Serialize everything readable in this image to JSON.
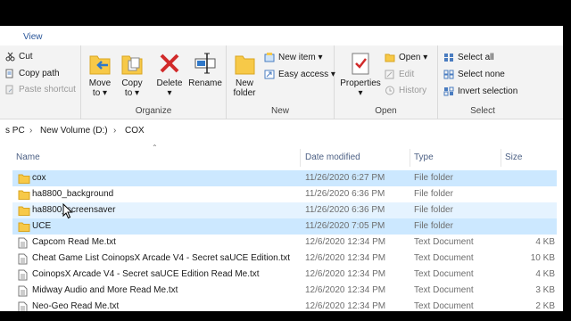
{
  "ribbon": {
    "tab": "View",
    "clipboard": {
      "cut": "Cut",
      "copy_path": "Copy path",
      "paste_shortcut": "Paste shortcut"
    },
    "organize": {
      "move_to": "Move",
      "move_to2": "to ▾",
      "copy_to": "Copy",
      "copy_to2": "to ▾",
      "delete": "Delete",
      "delete2": "▾",
      "rename": "Rename",
      "label": "Organize"
    },
    "new": {
      "new_folder": "New",
      "new_folder2": "folder",
      "new_item": "New item ▾",
      "easy_access": "Easy access ▾",
      "label": "New"
    },
    "open": {
      "properties": "Properties",
      "properties2": "▾",
      "open": "Open ▾",
      "edit": "Edit",
      "history": "History",
      "label": "Open"
    },
    "select": {
      "select_all": "Select all",
      "select_none": "Select none",
      "invert": "Invert selection",
      "label": "Select"
    }
  },
  "address": {
    "seg1": "s PC",
    "seg2": "New Volume (D:)",
    "seg3": "COX",
    "sep": "›"
  },
  "columns": {
    "name": "Name",
    "date": "Date modified",
    "type": "Type",
    "size": "Size"
  },
  "files": [
    {
      "name": "cox",
      "date": "11/26/2020 6:27 PM",
      "type": "File folder",
      "size": "",
      "kind": "folder",
      "state": "sel"
    },
    {
      "name": "ha8800_background",
      "date": "11/26/2020 6:36 PM",
      "type": "File folder",
      "size": "",
      "kind": "folder",
      "state": ""
    },
    {
      "name": "ha8800_screensaver",
      "date": "11/26/2020 6:36 PM",
      "type": "File folder",
      "size": "",
      "kind": "folder",
      "state": "hover"
    },
    {
      "name": "UCE",
      "date": "11/26/2020 7:05 PM",
      "type": "File folder",
      "size": "",
      "kind": "folder",
      "state": "sel"
    },
    {
      "name": "Capcom Read Me.txt",
      "date": "12/6/2020 12:34 PM",
      "type": "Text Document",
      "size": "4 KB",
      "kind": "txt",
      "state": ""
    },
    {
      "name": "Cheat Game List CoinopsX Arcade V4 - Secret saUCE Edition.txt",
      "date": "12/6/2020 12:34 PM",
      "type": "Text Document",
      "size": "10 KB",
      "kind": "txt",
      "state": ""
    },
    {
      "name": "CoinopsX Arcade V4 - Secret saUCE Edition Read Me.txt",
      "date": "12/6/2020 12:34 PM",
      "type": "Text Document",
      "size": "4 KB",
      "kind": "txt",
      "state": ""
    },
    {
      "name": "Midway Audio and More Read Me.txt",
      "date": "12/6/2020 12:34 PM",
      "type": "Text Document",
      "size": "3 KB",
      "kind": "txt",
      "state": ""
    },
    {
      "name": "Neo-Geo Read Me.txt",
      "date": "12/6/2020 12:34 PM",
      "type": "Text Document",
      "size": "2 KB",
      "kind": "txt",
      "state": ""
    }
  ]
}
